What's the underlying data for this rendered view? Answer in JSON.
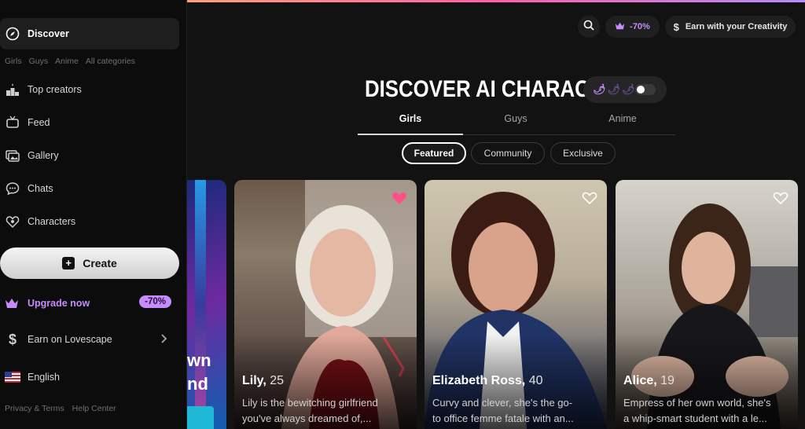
{
  "sidebar": {
    "discover": "Discover",
    "categories": [
      "Girls",
      "Guys",
      "Anime",
      "All categories"
    ],
    "items": [
      {
        "label": "Top creators",
        "icon": "podium-icon"
      },
      {
        "label": "Feed",
        "icon": "tv-icon"
      },
      {
        "label": "Gallery",
        "icon": "gallery-icon"
      },
      {
        "label": "Chats",
        "icon": "chat-icon"
      },
      {
        "label": "Characters",
        "icon": "characters-icon"
      }
    ],
    "create": "Create",
    "upgrade": "Upgrade now",
    "upgrade_badge": "-70%",
    "earn": "Earn on Lovescape",
    "language": "English",
    "footer": [
      "Privacy & Terms",
      "Help Center"
    ]
  },
  "header": {
    "promo": "-70%",
    "earn": "Earn with your Creativity"
  },
  "main": {
    "title": "DISCOVER AI CHARACTERS",
    "tabs": [
      "Girls",
      "Guys",
      "Anime"
    ],
    "filters": [
      "Featured",
      "Community",
      "Exclusive"
    ],
    "partial_text": [
      "wn",
      "nd"
    ],
    "cards": [
      {
        "name": "Lily,",
        "age": "25",
        "desc1": "Lily is the bewitching girlfriend",
        "desc2": "you've always dreamed of,...",
        "liked": true
      },
      {
        "name": "Elizabeth Ross,",
        "age": "40",
        "desc1": "Curvy and clever, she's the go-",
        "desc2": "to office femme fatale with an...",
        "liked": false
      },
      {
        "name": "Alice,",
        "age": "19",
        "desc1": "Empress of her own world, she's",
        "desc2": "a whip-smart student with a le...",
        "liked": false
      }
    ]
  },
  "colors": {
    "accent": "#c58bff",
    "heart_liked": "#ff4f8b"
  }
}
